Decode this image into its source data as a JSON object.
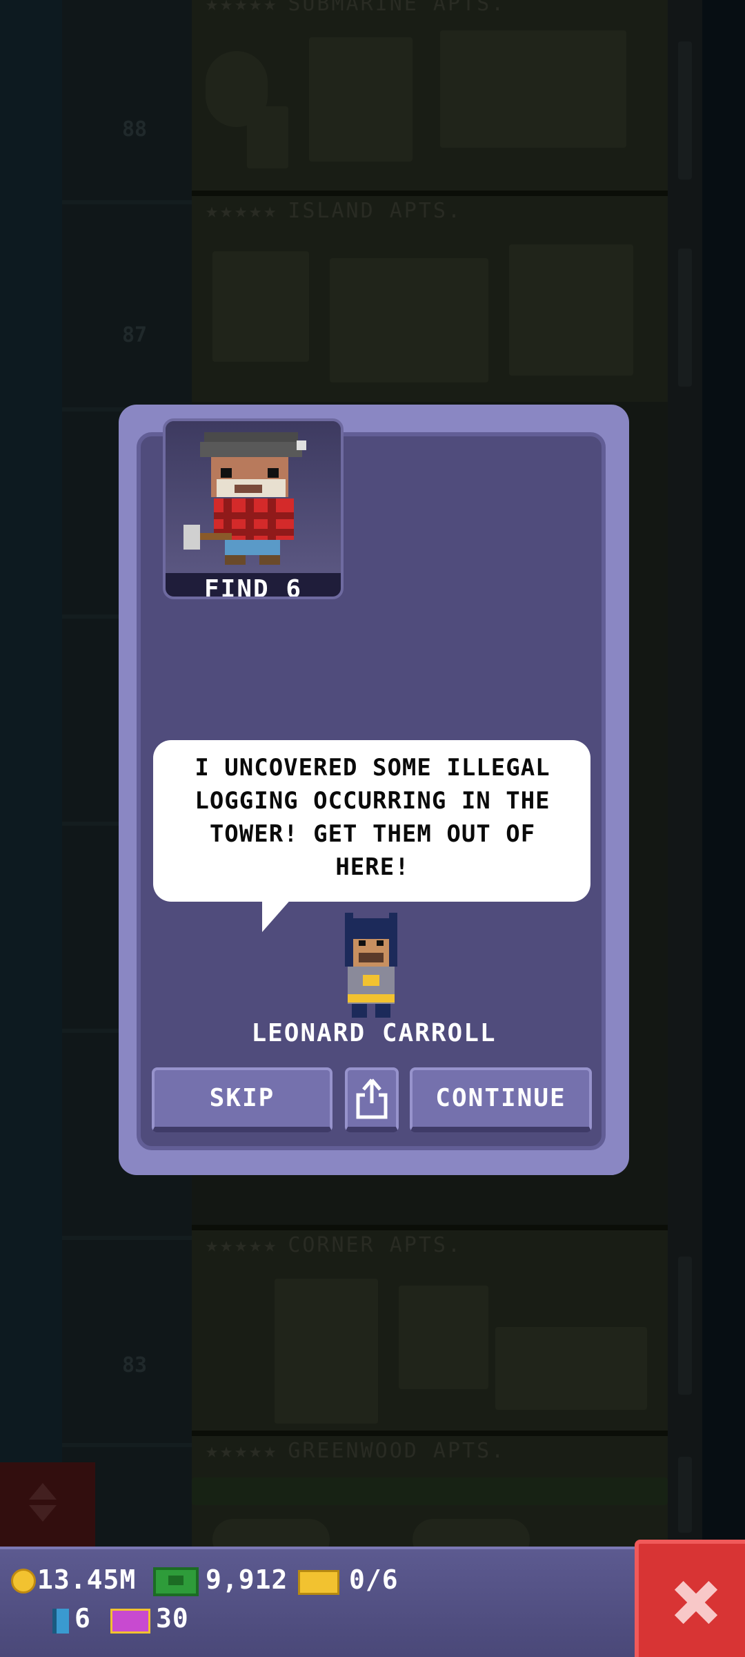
{
  "tower": {
    "floors": [
      {
        "label": "SUBMARINE APTS.",
        "number": "88"
      },
      {
        "label": "ISLAND APTS.",
        "number": "87"
      },
      {
        "label": "CORNER APTS.",
        "number": "83"
      },
      {
        "label": "GREENWOOD APTS.",
        "number": ""
      }
    ],
    "stars": "★★★★★"
  },
  "mission": {
    "find_label": "FIND 6",
    "speech": "I UNCOVERED SOME ILLEGAL LOGGING OCCURRING IN THE TOWER! GET THEM OUT OF HERE!",
    "speaker_name": "LEONARD CARROLL",
    "skip_label": "SKIP",
    "continue_label": "CONTINUE",
    "share_icon": "share-icon"
  },
  "status": {
    "coins": "13.45M",
    "bux_cash": "9,912",
    "tickets": "0/6",
    "bitizens": "6",
    "tower_bux": "30"
  },
  "colors": {
    "dialog_border": "#8a87c3",
    "dialog_fill": "#504c7c",
    "button": "#7571ad",
    "close_button": "#d83434"
  }
}
